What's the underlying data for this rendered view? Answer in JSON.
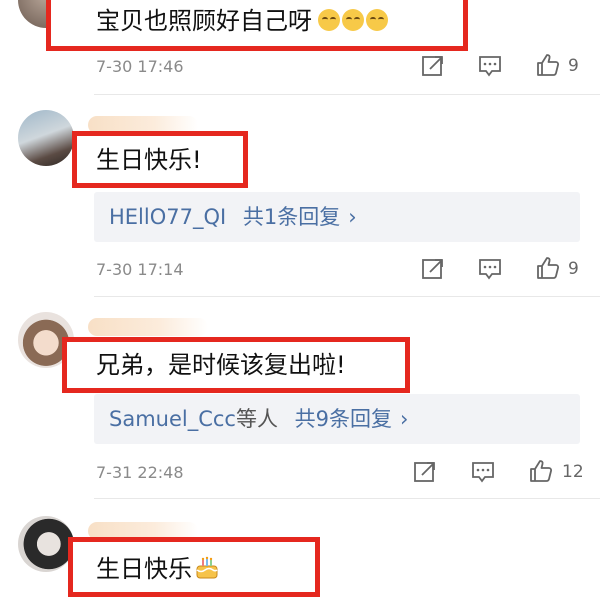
{
  "comments": [
    {
      "text": "宝贝也照顾好自己呀",
      "emoji": "blush-smile-emoji",
      "time": "7-30 17:46",
      "likes": "9"
    },
    {
      "text": "生日快乐!",
      "reply_user": "HEllO77_QI",
      "reply_summary": "共1条回复",
      "time": "7-30 17:14",
      "likes": "9"
    },
    {
      "text": "兄弟，是时候该复出啦!",
      "reply_user": "Samuel_Ccc",
      "reply_others": "等人",
      "reply_summary": "共9条回复",
      "time": "7-31 22:48",
      "likes": "12"
    },
    {
      "text": "生日快乐",
      "emoji": "birthday-cake-emoji"
    }
  ],
  "icons": {
    "forward": "forward-icon",
    "comment": "comment-icon",
    "like": "thumbs-up-icon",
    "chevron": "›"
  },
  "colors": {
    "highlight_border": "#e5281f",
    "link_blue": "#4a6fa3",
    "reply_bg": "#f2f3f6"
  }
}
